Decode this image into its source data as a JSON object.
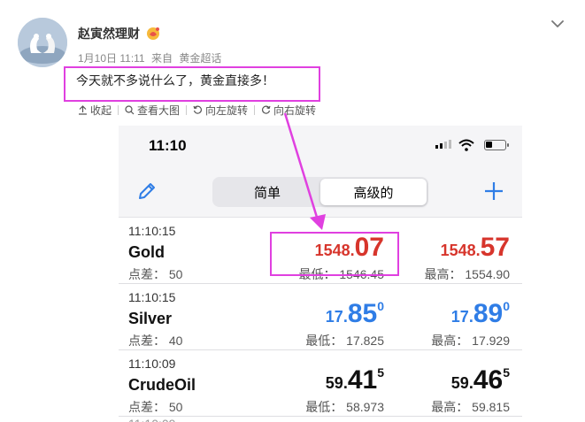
{
  "post": {
    "author": "赵寅然理财",
    "date": "1月10日 11:11",
    "source_prefix": "来自",
    "source": "黄金超话",
    "text": "今天就不多说什么了，黄金直接多！"
  },
  "toolbar": {
    "collapse": "收起",
    "view_large": "查看大图",
    "rotate_left": "向左旋转",
    "rotate_right": "向右旋转"
  },
  "phone": {
    "time": "11:10",
    "tabs": [
      "简单",
      "高级的"
    ],
    "active_tab": 1,
    "quotes": [
      {
        "time": "11:10:15",
        "symbol": "Gold",
        "spread": "点差： 50",
        "bid_pre": "1548.",
        "bid_big": "07",
        "bid_sup": "",
        "ask_pre": "1548.",
        "ask_big": "57",
        "ask_sup": "",
        "low": "最低： 1546.45",
        "high": "最高： 1554.90",
        "color": "#d7352c"
      },
      {
        "time": "11:10:15",
        "symbol": "Silver",
        "spread": "点差： 40",
        "bid_pre": "17.",
        "bid_big": "85",
        "bid_sup": "0",
        "ask_pre": "17.",
        "ask_big": "89",
        "ask_sup": "0",
        "low": "最低： 17.825",
        "high": "最高： 17.929",
        "color": "#2f7de6"
      },
      {
        "time": "11:10:09",
        "symbol": "CrudeOil",
        "spread": "点差： 50",
        "bid_pre": "59.",
        "bid_big": "41",
        "bid_sup": "5",
        "ask_pre": "59.",
        "ask_big": "46",
        "ask_sup": "5",
        "low": "最低： 58.973",
        "high": "最高： 59.815",
        "color": "#111111"
      }
    ]
  },
  "colors": {
    "highlight": "#e040e0",
    "down": "#d7352c",
    "up": "#2f7de6",
    "neutral": "#111111"
  },
  "icons": [
    "collapse-up-icon",
    "search-icon",
    "rotate-left-icon",
    "rotate-right-icon",
    "chevron-down-icon",
    "pencil-icon",
    "plus-icon",
    "wifi-icon",
    "battery-icon",
    "signal-icon",
    "fan-badge-icon"
  ]
}
